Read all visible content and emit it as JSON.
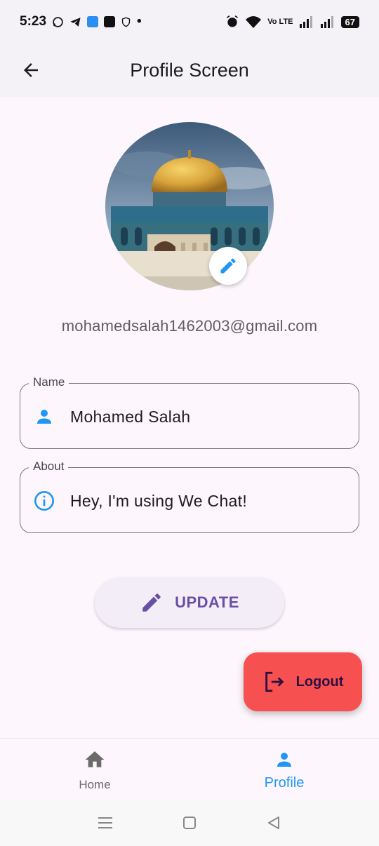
{
  "status_bar": {
    "time": "5:23",
    "network_label": "Vo LTE",
    "battery": "67",
    "dot": "•"
  },
  "app_bar": {
    "title": "Profile Screen",
    "back_icon": "arrow-back-icon"
  },
  "profile": {
    "avatar_alt": "profile-photo",
    "email": "mohamedsalah1462003@gmail.com",
    "edit_icon": "edit-pencil-icon"
  },
  "form": {
    "name": {
      "label": "Name",
      "value": "Mohamed Salah",
      "icon": "person-icon"
    },
    "about": {
      "label": "About",
      "value": "Hey, I'm using We Chat!",
      "icon": "info-icon"
    }
  },
  "update_button": {
    "label": "UPDATE",
    "icon": "edit-pencil-icon"
  },
  "logout_button": {
    "label": "Logout",
    "icon": "logout-icon"
  },
  "bottom_nav": {
    "items": [
      {
        "label": "Home",
        "icon": "home-icon",
        "selected": false
      },
      {
        "label": "Profile",
        "icon": "person-icon",
        "selected": true
      }
    ]
  },
  "system_nav": {
    "buttons": [
      "recents-icon",
      "home-square-icon",
      "back-triangle-icon"
    ]
  },
  "colors": {
    "accent_blue": "#2196f3",
    "update_purple": "#6750a4",
    "logout_red": "#f65050",
    "app_bar_bg": "#f4f2f6",
    "page_bg": "#fdf7fd"
  }
}
